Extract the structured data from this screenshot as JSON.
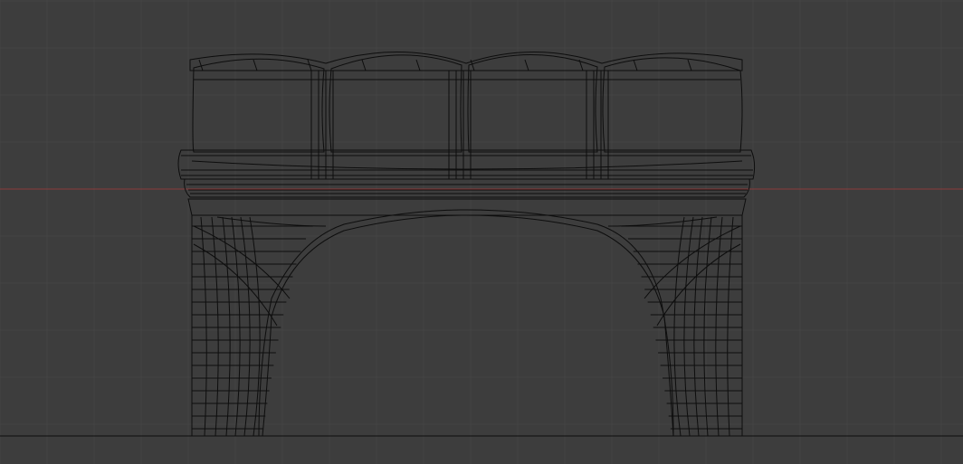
{
  "viewport": {
    "background_color": "#3d3d3d",
    "grid_color": "#444444",
    "x_axis_color": "#8a3b3b",
    "wire_color": "#0d0d0d",
    "grid_visible": true,
    "view": "front-orthographic",
    "shading": "wireframe"
  },
  "object": {
    "kind": "upholstered-bench",
    "cushion_count": 4,
    "legs": 2
  }
}
